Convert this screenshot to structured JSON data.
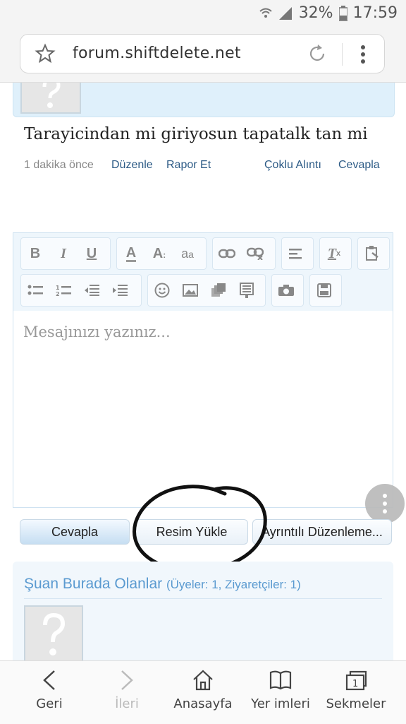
{
  "status_bar": {
    "battery": "32%",
    "time": "17:59"
  },
  "browser": {
    "url": "forum.shiftdelete.net"
  },
  "post": {
    "text": "Tarayicindan mi giriyosun tapatalk tan mi",
    "time": "1 dakika önce",
    "edit_label": "Düzenle",
    "report_label": "Rapor Et",
    "multi_quote_label": "Çoklu Alıntı",
    "reply_label": "Cevapla"
  },
  "editor": {
    "placeholder": "Mesajınızı yazınız...",
    "toolbar_icons": [
      "bold-icon",
      "italic-icon",
      "underline-icon",
      "font-color-icon",
      "font-size-icon",
      "font-family-icon",
      "link-icon",
      "unlink-icon",
      "align-icon",
      "remove-format-icon",
      "paste-icon",
      "bullet-list-icon",
      "numbered-list-icon",
      "outdent-icon",
      "indent-icon",
      "smilies-icon",
      "image-icon",
      "media-icon",
      "quote-icon",
      "camera-icon",
      "save-icon"
    ]
  },
  "buttons": {
    "reply": "Cevapla",
    "upload_image": "Resim Yükle",
    "advanced_edit": "Ayrıntılı Düzenleme..."
  },
  "online": {
    "title": "Şuan Burada Olanlar",
    "subtitle": "(Üyeler: 1, Ziyaretçiler: 1)"
  },
  "nav": {
    "back": "Geri",
    "forward": "İleri",
    "home": "Anasayfa",
    "bookmarks": "Yer imleri",
    "tabs": "Sekmeler",
    "tab_count": "1"
  },
  "colors": {
    "link": "#2d5b86",
    "accent": "#5a9ad0"
  }
}
